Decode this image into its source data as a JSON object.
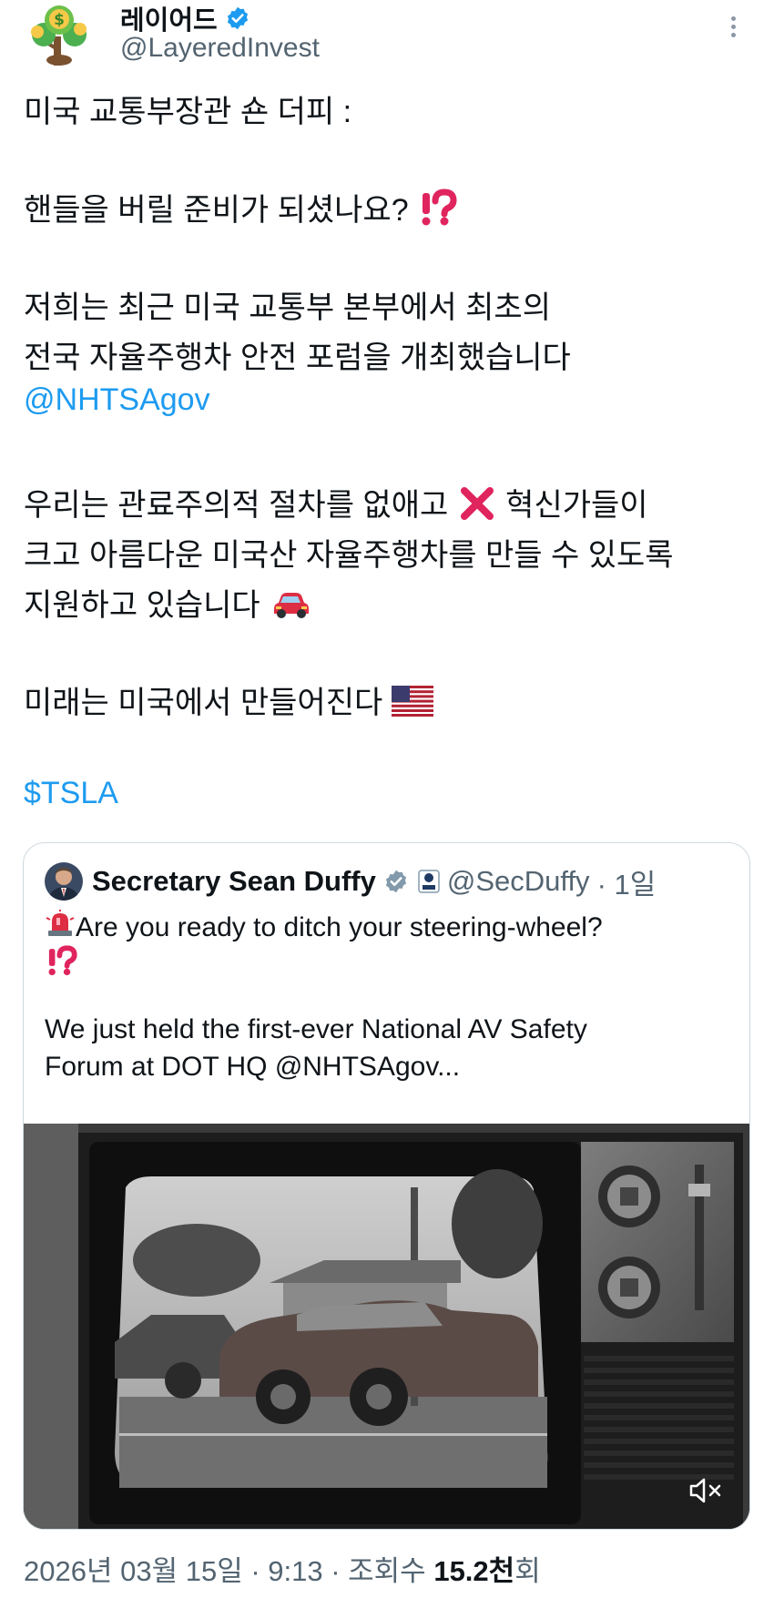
{
  "author": {
    "display_name": "레이어드",
    "handle": "@LayeredInvest"
  },
  "tweet": {
    "lines": [
      "미국 교통부장관 숀 더피 :",
      "핸들을 버릴 준비가 되셨나요? ",
      "저희는 최근 미국 교통부 본부에서 최초의",
      "전국 자율주행차 안전 포럼을 개최했습니다",
      "@NHTSAgov",
      "우리는 관료주의적 절차를 없애고 ",
      " 혁신가들이",
      "크고 아름다운 미국산 자율주행차를 만들 수 있도록",
      "지원하고 있습니다 ",
      "미래는 미국에서 만들어진다 ",
      "$TSLA"
    ]
  },
  "quote": {
    "display_name": "Secretary Sean Duffy",
    "handle": "@SecDuffy",
    "time": "· 1일",
    "line1": " Are you ready to ditch your steering-wheel?",
    "line3": "We just held the first-ever National AV Safety",
    "line4": "Forum at DOT HQ @NHTSAgov..."
  },
  "meta": {
    "date": "2026년 03월 15일 · 9:13 · 조회수 ",
    "views": "15.2천",
    "views_suffix": "회"
  },
  "colors": {
    "link": "#1d9bf0",
    "verified": "#1d9bf0",
    "muted": "#536471"
  }
}
